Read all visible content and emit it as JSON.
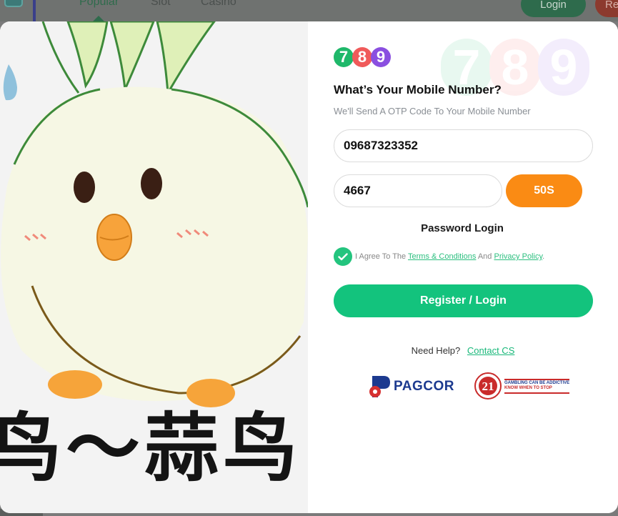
{
  "background": {
    "nav": [
      "Popular",
      "Slot",
      "Casino"
    ],
    "login_label": "Login",
    "register_label": "Re"
  },
  "art": {
    "caption": "鸟～蒜鸟"
  },
  "logo": {
    "digits": [
      "7",
      "8",
      "9"
    ]
  },
  "form": {
    "title": "What’s Your Mobile Number?",
    "subtitle": "We'll Send A OTP Code To Your Mobile Number",
    "phone_value": "09687323352",
    "otp_value": "4667",
    "timer_label": "50S",
    "password_login_label": "Password Login",
    "agree_prefix": "I Agree To The",
    "terms_label": "Terms & Conditions",
    "and_label": "And",
    "privacy_label": "Privacy Policy",
    "period": ".",
    "agreed": true,
    "submit_label": "Register / Login",
    "help_label": "Need Help?",
    "contact_label": "Contact CS"
  },
  "footer": {
    "pagcor_label": "PAGCOR",
    "age_badge": "21",
    "rg_line1": "GAMBLING CAN BE ADDICTIVE",
    "rg_line2": "KNOW WHEN TO STOP"
  },
  "colors": {
    "primary": "#13c37d",
    "timer": "#fa8b14",
    "link": "#2bbf7f",
    "logo_7": "#1fb86a",
    "logo_8": "#f05a5a",
    "logo_9": "#8a4fe0"
  }
}
